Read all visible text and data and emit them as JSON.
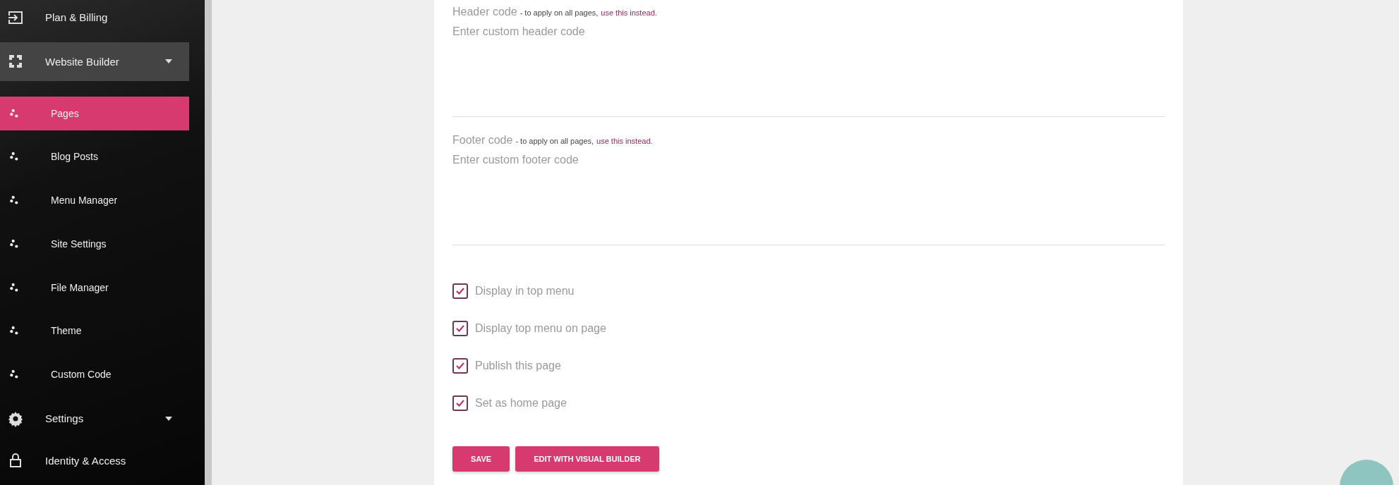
{
  "sidebar": {
    "items": [
      {
        "kind": "link",
        "label": "Plan & Billing",
        "selected": false
      },
      {
        "kind": "group",
        "label": "Website Builder",
        "selected": false,
        "expanded": true,
        "children": [
          {
            "label": "Pages",
            "selected": true
          },
          {
            "label": "Blog Posts",
            "selected": false
          },
          {
            "label": "Menu Manager",
            "selected": false
          },
          {
            "label": "Site Settings",
            "selected": false
          },
          {
            "label": "File Manager",
            "selected": false
          },
          {
            "label": "Theme",
            "selected": false
          },
          {
            "label": "Custom Code",
            "selected": false
          }
        ]
      },
      {
        "kind": "group",
        "label": "Settings",
        "selected": false,
        "expanded": false
      },
      {
        "kind": "link",
        "label": "Identity & Access",
        "selected": false
      }
    ]
  },
  "code_fields": [
    {
      "label": "Header code",
      "hint": "- to apply on all pages,",
      "link": "use this instead.",
      "placeholder": "Enter custom header code"
    },
    {
      "label": "Footer code",
      "hint": "- to apply on all pages,",
      "link": "use this instead.",
      "placeholder": "Enter custom footer code"
    }
  ],
  "options": [
    {
      "label": "Display in top menu",
      "checked": true
    },
    {
      "label": "Display top menu on page",
      "checked": true
    },
    {
      "label": "Publish this page",
      "checked": true
    },
    {
      "label": "Set as home page",
      "checked": true
    }
  ],
  "buttons": [
    "SAVE",
    "EDIT WITH VISUAL BUILDER"
  ]
}
